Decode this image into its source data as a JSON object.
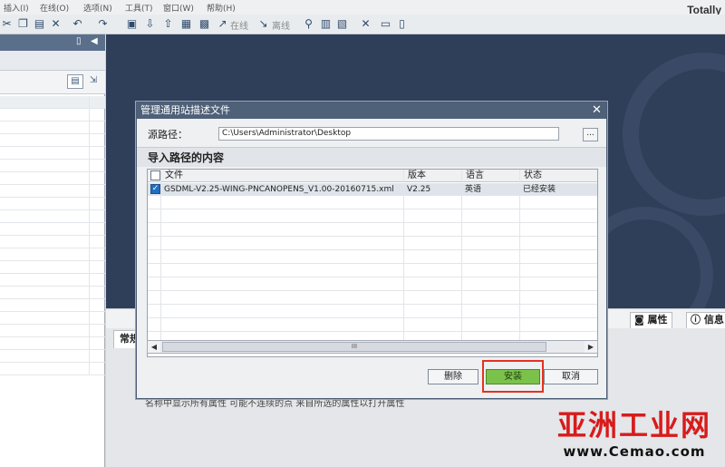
{
  "menubar": {
    "items": [
      "插入(I)",
      "在线(O)",
      "选项(N)",
      "工具(T)",
      "窗口(W)",
      "帮助(H)"
    ],
    "brand": "Totally"
  },
  "toolbar": {
    "online_label": "在线",
    "offline_label": "离线",
    "icons": [
      "cut-icon",
      "copy-icon",
      "paste-icon",
      "delete-icon",
      "undo-icon",
      "redo-icon",
      "download-icon",
      "upload-icon",
      "compile-icon",
      "go-online-icon",
      "go-offline-icon",
      "accessible-devices-icon",
      "split-horizontal-icon",
      "split-vertical-icon"
    ]
  },
  "properties": {
    "properties_tab": "属性",
    "info_tab": "信息",
    "general_tab": "常规",
    "behind_text": "名称中显示所有属性    可能不连续的点   来自所选的属性以打开属性"
  },
  "dialog": {
    "title": "管理通用站描述文件",
    "source_path_label": "源路径：",
    "source_path_value": "C:\\Users\\Administrator\\Desktop",
    "browse_label": "...",
    "section_title": "导入路径的内容",
    "columns": {
      "file": "文件",
      "version": "版本",
      "language": "语言",
      "status": "状态"
    },
    "rows": [
      {
        "checked": true,
        "file": "GSDML-V2.25-WING-PNCANOPENS_V1.00-20160715.xml",
        "version": "V2.25",
        "language": "英语",
        "status": "已经安装"
      }
    ],
    "scroll_thumb_label": "III",
    "buttons": {
      "delete": "删除",
      "install": "安装",
      "cancel": "取消"
    }
  },
  "watermark": {
    "main": "亚洲工业网",
    "url": "www.Cemao.com"
  },
  "colors": {
    "workspace": "#2f3e59",
    "dialog_title": "#4f6178",
    "install_button": "#7bc24a",
    "highlight": "#e53222",
    "watermark": "#d81b1b"
  }
}
